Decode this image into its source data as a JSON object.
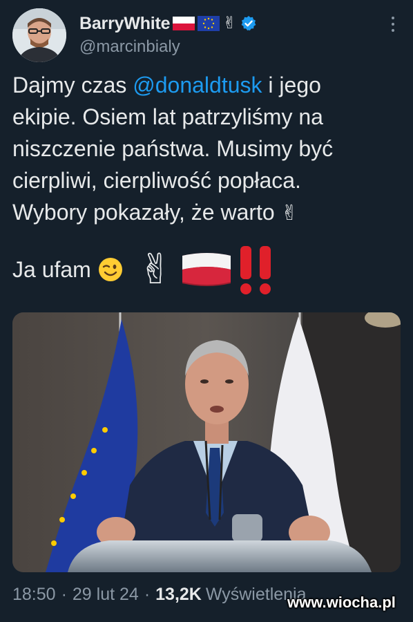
{
  "tweet": {
    "author": {
      "display_name": "BarryWhite",
      "handle": "@marcinbialy",
      "verified": true,
      "name_emojis": [
        "poland-flag",
        "eu-flag",
        "victory-hand"
      ]
    },
    "text": {
      "line1_pre": "Dajmy czas ",
      "line1_mention": "@donaldtusk",
      "line1_post": " i jego",
      "line2": "ekipie. Osiem lat patrzyliśmy na",
      "line3": "niszczenie państwa. Musimy być",
      "line4": "cierpliwi, cierpliwość popłaca.",
      "line5": "Wybory pokazały, że warto",
      "line5_emoji": "✌",
      "line6": "Ja ufam"
    },
    "emoji_row": [
      "winking-face",
      "victory-hand",
      "poland-flag",
      "double-exclamation"
    ],
    "media": {
      "description_icons": [
        "eu-flag",
        "poland-flag",
        "speaker-at-podium"
      ]
    },
    "meta": {
      "time": "18:50",
      "date": "29 lut 24",
      "views_count": "13,2K",
      "views_label": "Wyświetlenia"
    },
    "watermark": "www.wiocha.pl"
  },
  "colors": {
    "background": "#15202b",
    "text": "#e7e9ea",
    "secondary": "#8b98a5",
    "accent": "#1d9bf0"
  }
}
